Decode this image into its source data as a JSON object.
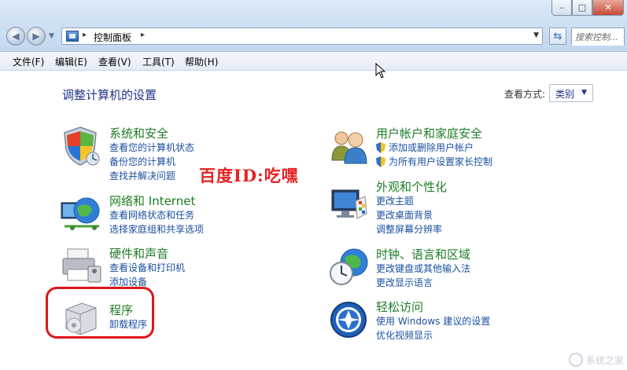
{
  "address": {
    "crumb": "控制面板",
    "sep": "▸"
  },
  "search": {
    "placeholder": "搜索控制..."
  },
  "window_buttons": {
    "minimize": "–",
    "maximize": "□",
    "close": "✕"
  },
  "menu": [
    "文件(F)",
    "编辑(E)",
    "查看(V)",
    "工具(T)",
    "帮助(H)"
  ],
  "page_title": "调整计算机的设置",
  "view_by": {
    "label": "查看方式:",
    "value": "类别"
  },
  "categories": [
    {
      "title": "系统和安全",
      "icon": "shield-flag-icon",
      "links": [
        "查看您的计算机状态",
        "备份您的计算机",
        "查找并解决问题"
      ]
    },
    {
      "title": "网络和 Internet",
      "icon": "globe-network-icon",
      "links": [
        "查看网络状态和任务",
        "选择家庭组和共享选项"
      ]
    },
    {
      "title": "硬件和声音",
      "icon": "printer-icon",
      "links": [
        "查看设备和打印机",
        "添加设备"
      ]
    },
    {
      "title": "程序",
      "icon": "programs-box-icon",
      "links": [
        "卸载程序"
      ]
    },
    {
      "title": "用户帐户和家庭安全",
      "icon": "users-icon",
      "links": [
        "添加或删除用户帐户",
        "为所有用户设置家长控制"
      ],
      "link_shields": [
        true,
        true
      ]
    },
    {
      "title": "外观和个性化",
      "icon": "monitor-palette-icon",
      "links": [
        "更改主题",
        "更改桌面背景",
        "调整屏幕分辨率"
      ]
    },
    {
      "title": "时钟、语言和区域",
      "icon": "clock-globe-icon",
      "links": [
        "更改键盘或其他输入法",
        "更改显示语言"
      ]
    },
    {
      "title": "轻松访问",
      "icon": "ease-of-access-icon",
      "links": [
        "使用 Windows 建议的设置",
        "优化视频显示"
      ]
    }
  ],
  "watermark": "百度ID:吃嘿",
  "corner_watermark": "系统之家",
  "colors": {
    "category_title": "#1e7d27",
    "link": "#1a4fa0",
    "page_title": "#1e3287",
    "highlight": "#e0141b",
    "watermark": "#e52222"
  }
}
